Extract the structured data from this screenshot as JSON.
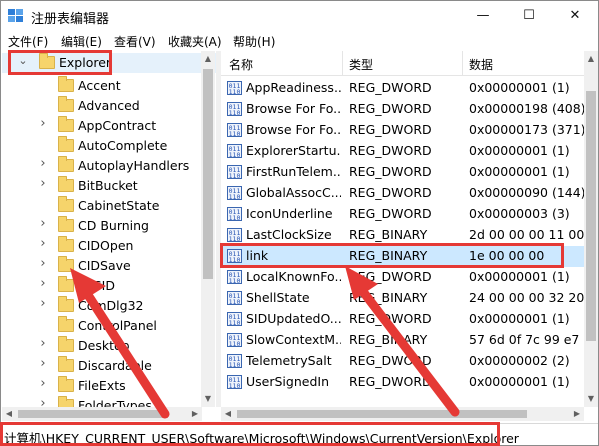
{
  "window": {
    "title": "注册表编辑器",
    "controls": {
      "minimize": "—",
      "maximize": "☐",
      "close": "✕"
    }
  },
  "menu": [
    "文件(F)",
    "编辑(E)",
    "查看(V)",
    "收藏夹(A)",
    "帮助(H)"
  ],
  "tree": {
    "selected": {
      "label": "Explorer",
      "expander": "⌄"
    },
    "children": [
      {
        "label": "Accent",
        "has_children": false
      },
      {
        "label": "Advanced",
        "has_children": false
      },
      {
        "label": "AppContract",
        "has_children": true
      },
      {
        "label": "AutoComplete",
        "has_children": false
      },
      {
        "label": "AutoplayHandlers",
        "has_children": true
      },
      {
        "label": "BitBucket",
        "has_children": true
      },
      {
        "label": "CabinetState",
        "has_children": false
      },
      {
        "label": "CD Burning",
        "has_children": true
      },
      {
        "label": "CIDOpen",
        "has_children": true
      },
      {
        "label": "CIDSave",
        "has_children": true
      },
      {
        "label": "CLSID",
        "has_children": true
      },
      {
        "label": "ComDlg32",
        "has_children": true
      },
      {
        "label": "ControlPanel",
        "has_children": false
      },
      {
        "label": "Desktop",
        "has_children": true
      },
      {
        "label": "Discardable",
        "has_children": true
      },
      {
        "label": "FileExts",
        "has_children": true
      },
      {
        "label": "FolderTypes",
        "has_children": true
      }
    ]
  },
  "list": {
    "columns": [
      "名称",
      "类型",
      "数据"
    ],
    "rows": [
      {
        "name": "AppReadiness...",
        "type": "REG_DWORD",
        "data": "0x00000001 (1)"
      },
      {
        "name": "Browse For Fo...",
        "type": "REG_DWORD",
        "data": "0x00000198 (408)"
      },
      {
        "name": "Browse For Fo...",
        "type": "REG_DWORD",
        "data": "0x00000173 (371)"
      },
      {
        "name": "ExplorerStartu...",
        "type": "REG_DWORD",
        "data": "0x00000001 (1)"
      },
      {
        "name": "FirstRunTelem...",
        "type": "REG_DWORD",
        "data": "0x00000001 (1)"
      },
      {
        "name": "GlobalAssocC...",
        "type": "REG_DWORD",
        "data": "0x00000090 (144)"
      },
      {
        "name": "IconUnderline",
        "type": "REG_DWORD",
        "data": "0x00000003 (3)"
      },
      {
        "name": "LastClockSize",
        "type": "REG_BINARY",
        "data": "2d 00 00 00 11 00"
      },
      {
        "name": "link",
        "type": "REG_BINARY",
        "data": "1e 00 00 00",
        "selected": true
      },
      {
        "name": "LocalKnownFo...",
        "type": "REG_DWORD",
        "data": "0x00000001 (1)"
      },
      {
        "name": "ShellState",
        "type": "REG_BINARY",
        "data": "24 00 00 00 32 20 0"
      },
      {
        "name": "SIDUpdatedO...",
        "type": "REG_DWORD",
        "data": "0x00000001 (1)"
      },
      {
        "name": "SlowContextM...",
        "type": "REG_BINARY",
        "data": "57 6d 0f 7c 99 e7 8"
      },
      {
        "name": "TelemetrySalt",
        "type": "REG_DWORD",
        "data": "0x00000002 (2)"
      },
      {
        "name": "UserSignedIn",
        "type": "REG_DWORD",
        "data": "0x00000001 (1)"
      }
    ]
  },
  "value_icon_glyph": "011\n110",
  "statusbar": {
    "path": "计算机\\HKEY_CURRENT_USER\\Software\\Microsoft\\Windows\\CurrentVersion\\Explorer"
  },
  "colors": {
    "annotation": "#e53935",
    "selection": "#cce8ff",
    "folder": "#f6d46b"
  }
}
